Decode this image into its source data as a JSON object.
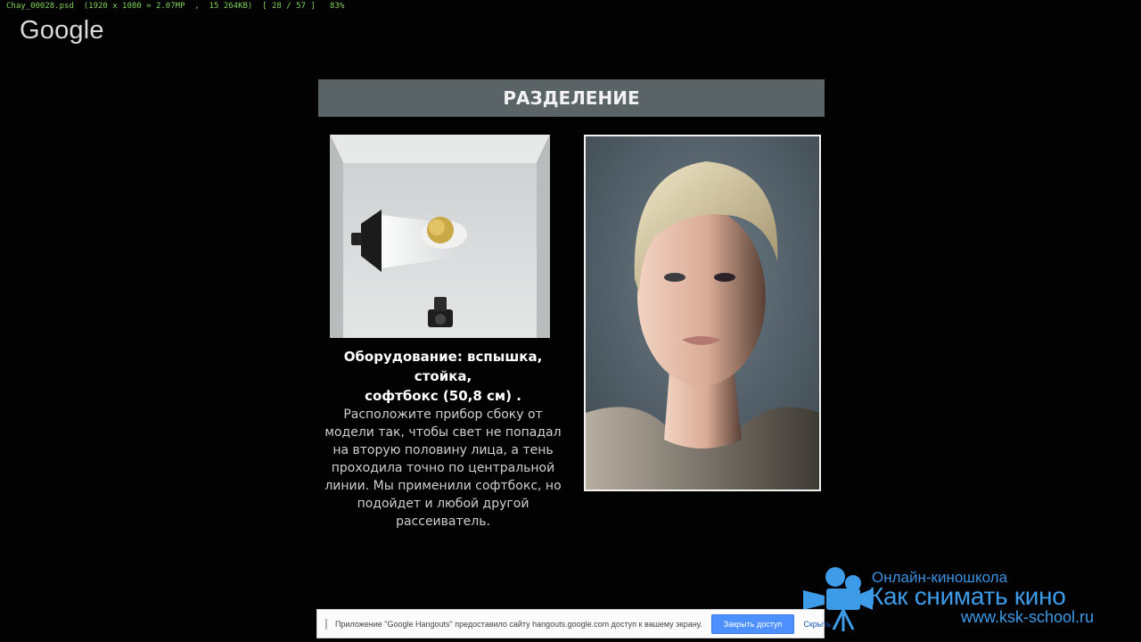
{
  "viewer": {
    "status": "Chay_00028.psd  (1920 x 1080 = 2.07MP  ,  15 264KB)  [ 28 / 57 ]   83%"
  },
  "google_logo": {
    "text": "Google"
  },
  "slide": {
    "title": "РАЗДЕЛЕНИЕ",
    "caption_bold_1": "Оборудование: вспышка, стойка,",
    "caption_bold_2": "софтбокс (50,8 см) .",
    "caption_lines": [
      "Расположите прибор сбоку от",
      "модели так, чтобы свет не попадал",
      "на вторую половину лица, а тень",
      "проходила точно по центральной",
      "линии. Мы применили софтбокс, но",
      "подойдет и любой другой",
      "рассеиватель."
    ]
  },
  "school": {
    "subtitle": "Онлайн-киношкола",
    "name": "Как снимать кино",
    "url": "www.ksk-school.ru",
    "accent": "#3d9be8"
  },
  "share_bar": {
    "message": "Приложение \"Google Hangouts\" предоставило сайту hangouts.google.com доступ к вашему экрану.",
    "stop_label": "Закрыть доступ",
    "hide_label": "Скрыть"
  },
  "colors": {
    "background": "#020202",
    "title_bar": "#5a6466",
    "status_text": "#7fd35a",
    "button": "#4d90fe"
  }
}
